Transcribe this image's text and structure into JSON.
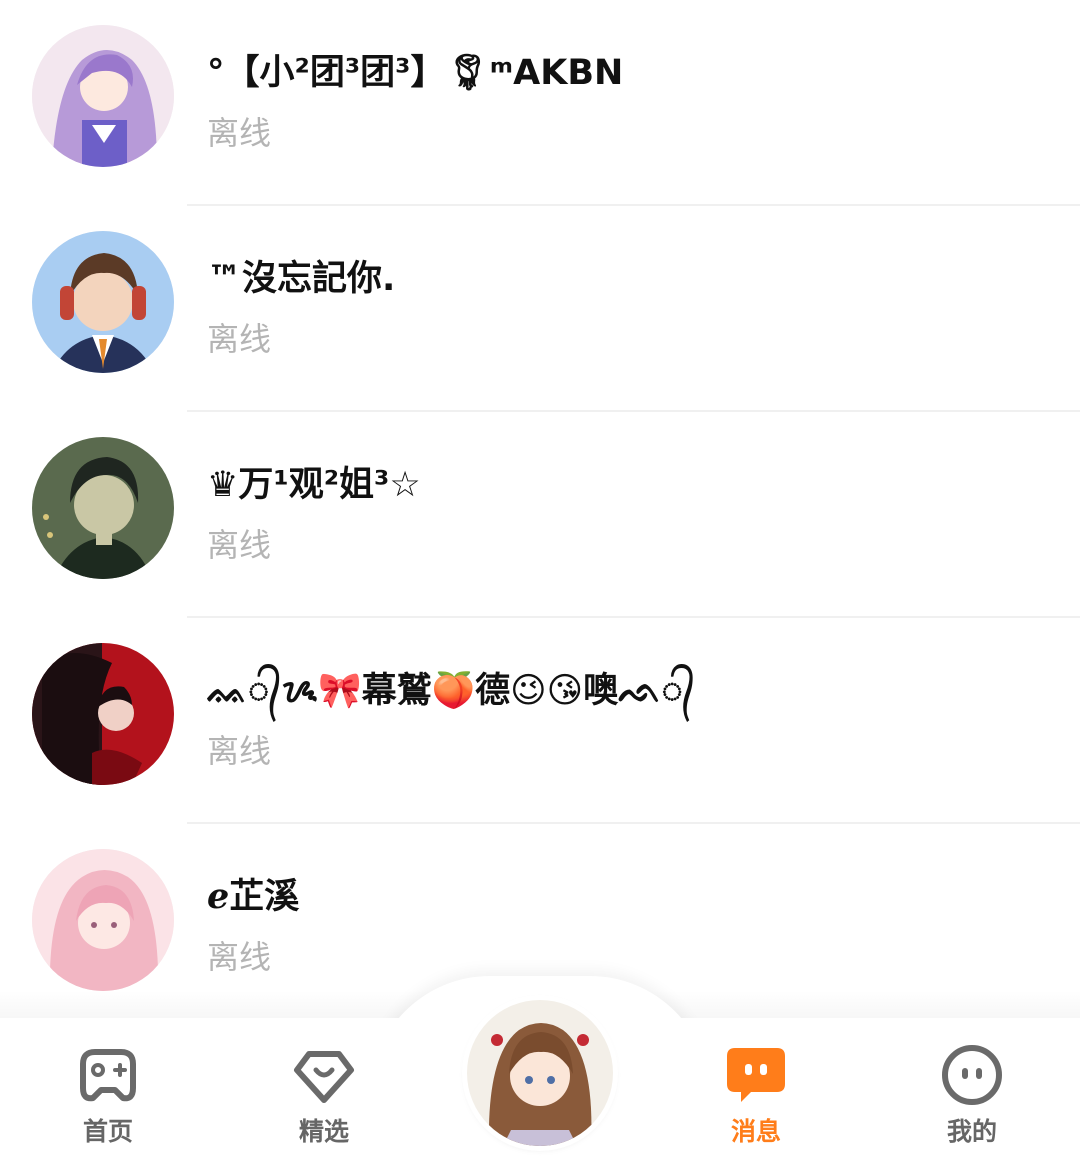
{
  "contacts": [
    {
      "name": "°【小²团³团³】🌹︎ᵐAKBN",
      "status": "离线"
    },
    {
      "name": "™沒忘記你.",
      "status": "离线"
    },
    {
      "name": "♛万¹观²姐³☆",
      "status": "离线"
    },
    {
      "name": "ᨐ᭄ᝰ🎀幕鷲🍑德😉😘噢ᨒ᭄",
      "status": "离线"
    },
    {
      "name": "︎︎︎ℯ︎︎︎芷溪",
      "status": "离线"
    }
  ],
  "tabs": [
    {
      "label": "首页",
      "icon": "gamepad-icon"
    },
    {
      "label": "精选",
      "icon": "heart-gem-icon"
    },
    {
      "label": "消息",
      "icon": "chat-bubble-icon",
      "active": true
    },
    {
      "label": "我的",
      "icon": "face-icon"
    }
  ],
  "colors": {
    "accent": "#ff7d1a",
    "status": "#b4b4b4",
    "divider": "#f0f0f0"
  }
}
